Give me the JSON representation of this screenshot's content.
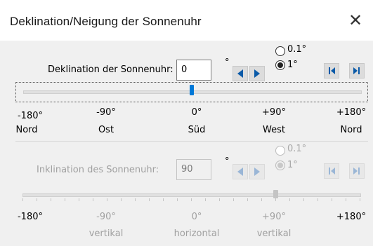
{
  "window": {
    "title": "Deklination/Neigung der Sonnenuhr",
    "close_glyph": "✕"
  },
  "declination": {
    "label": "Deklination der Sonnenuhr:",
    "value": "0",
    "degree_symbol": "°",
    "step_options": [
      {
        "label": "0.1°",
        "checked": false
      },
      {
        "label": "1°",
        "checked": true
      }
    ],
    "slider_value_deg": 0,
    "slider_range": [
      -180,
      180
    ],
    "scale_degrees": [
      "-180°",
      "-90°",
      "0°",
      "+90°",
      "+180°"
    ],
    "scale_directions": [
      "Nord",
      "Ost",
      "Süd",
      "West",
      "Nord"
    ],
    "enabled": true
  },
  "inclination": {
    "label": "Inklination des Sonnenuhr:",
    "value": "90",
    "degree_symbol": "°",
    "step_options": [
      {
        "label": "0.1°",
        "checked": false
      },
      {
        "label": "1°",
        "checked": true
      }
    ],
    "slider_value_deg": 90,
    "slider_range": [
      -180,
      180
    ],
    "scale_degrees": [
      "-180°",
      "-90°",
      "0°",
      "+90°",
      "+180°"
    ],
    "scale_orientations": [
      "vertikal",
      "horizontal",
      "vertikal"
    ],
    "enabled": false
  },
  "colors": {
    "accent": "#0078d7",
    "arrow": "#0a5aa8",
    "disabled_text": "#a0a0a0"
  },
  "icons": [
    "close-icon",
    "arrow-left-icon",
    "arrow-right-icon",
    "skip-start-icon",
    "skip-end-icon"
  ]
}
